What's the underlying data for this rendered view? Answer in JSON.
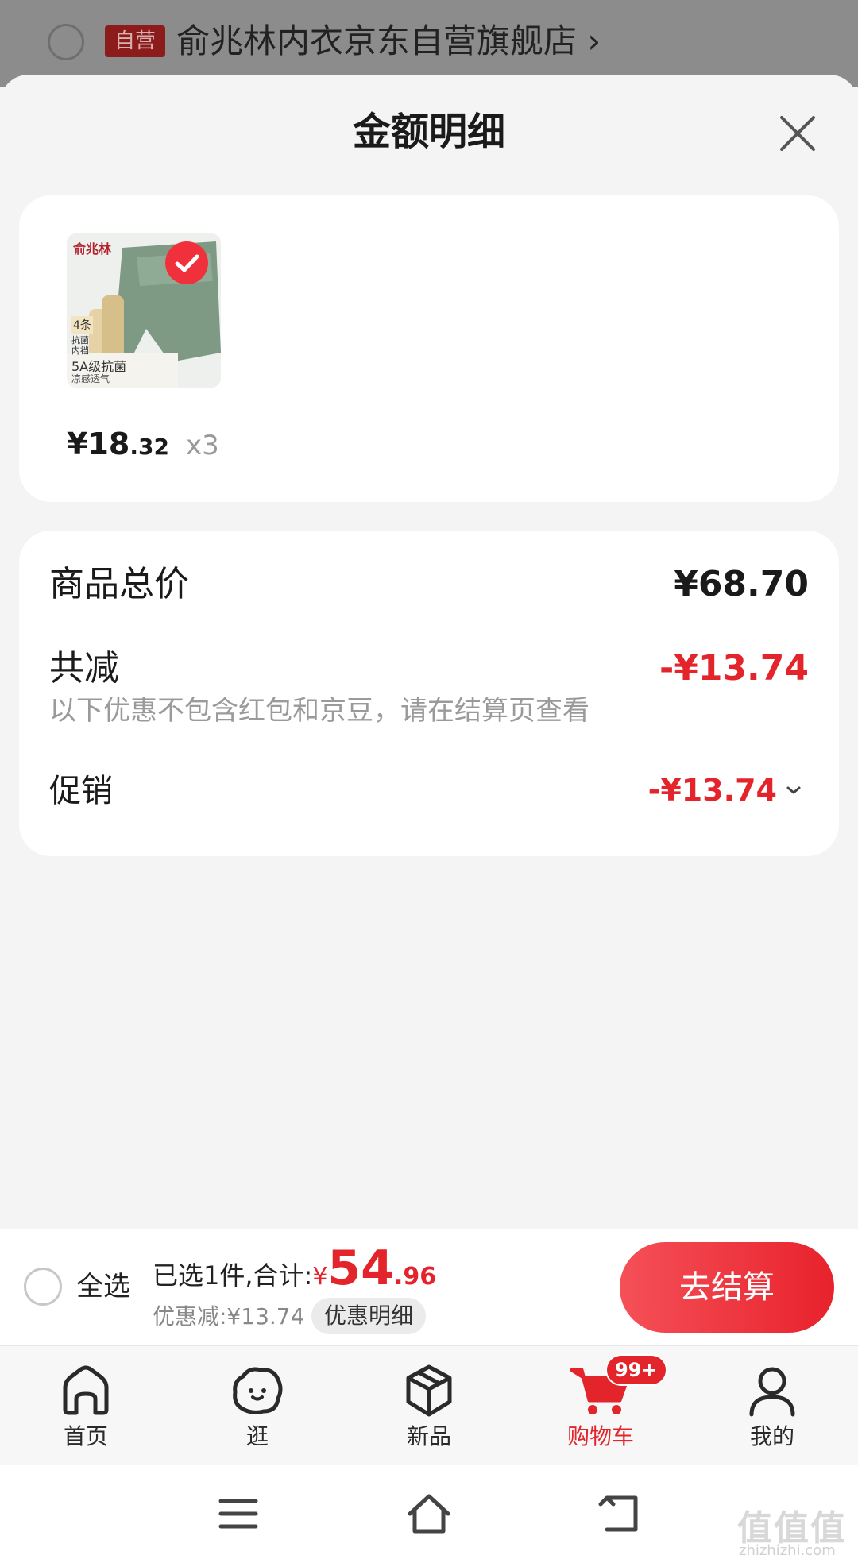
{
  "store": {
    "badge": "自营",
    "name": "俞兆林内衣京东自营旗舰店",
    "arrow": "›"
  },
  "sheet": {
    "title": "金额明细"
  },
  "product": {
    "price_int": "¥18",
    "price_dec": ".32",
    "qty": "x3",
    "thumb_brand": "俞兆林",
    "thumb_tag1": "4条",
    "thumb_tag2": "抗菌内裆",
    "thumb_tag3": "5A级抗菌",
    "thumb_tag4": "凉感透气"
  },
  "summary": {
    "total_label": "商品总价",
    "total_value": "¥68.70",
    "reduce_label": "共减",
    "reduce_value": "-¥13.74",
    "note": "以下优惠不包含红包和京豆，请在结算页查看",
    "promo_label": "促销",
    "promo_value": "-¥13.74"
  },
  "checkout": {
    "select_all": "全选",
    "selected_text": "已选1件,合计:",
    "yen": "¥",
    "amount_int": "54",
    "amount_dec": ".96",
    "discount_text": "优惠减:¥13.74",
    "discount_detail": "优惠明细",
    "pay": "去结算"
  },
  "tabs": [
    {
      "label": "首页",
      "icon": "home-icon"
    },
    {
      "label": "逛",
      "icon": "browse-icon"
    },
    {
      "label": "新品",
      "icon": "new-products-icon"
    },
    {
      "label": "购物车",
      "icon": "cart-icon",
      "badge": "99+"
    },
    {
      "label": "我的",
      "icon": "profile-icon"
    }
  ],
  "watermark": {
    "text": "值值值",
    "sub": "zhizhizhi.com"
  },
  "colors": {
    "accent": "#e3242b",
    "overlay": "#8c8c8c"
  }
}
